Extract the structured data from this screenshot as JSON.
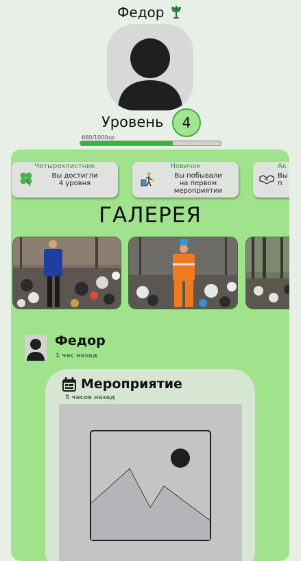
{
  "header": {
    "name": "Федор",
    "logo_icon": "tree-leaf-icon"
  },
  "profile": {
    "avatar_icon": "user-silhouette-icon",
    "level_label": "Уровень",
    "level_value": "4",
    "xp_text": "660/1000xp",
    "xp_progress": 0.66
  },
  "achievements": [
    {
      "title": "Четырехлистник",
      "desc": [
        "Вы достигли",
        "4 уровня"
      ],
      "icon": "clover-icon"
    },
    {
      "title": "Новичок",
      "desc": [
        "Вы побывали",
        "на первом",
        "мероприятии"
      ],
      "icon": "volunteer-cleanup-icon"
    },
    {
      "title": "Ак",
      "desc": [
        "Вы",
        "п"
      ],
      "icon": "handshake-icon"
    }
  ],
  "gallery": {
    "title": "ГАЛЕРЕЯ",
    "photos": [
      "volunteer-blue-jacket-photo",
      "volunteer-orange-jacket-photo",
      "trash-forest-photo"
    ]
  },
  "post": {
    "author": "Федор",
    "time": "1 час назад",
    "event": {
      "title": "Мероприятие",
      "time": "5 часов назад",
      "calendar_icon": "calendar-icon",
      "image_icon": "image-placeholder-icon"
    }
  },
  "colors": {
    "panel": "#a1e38d",
    "accent_green": "#36b53c",
    "background": "#e8efe6"
  }
}
